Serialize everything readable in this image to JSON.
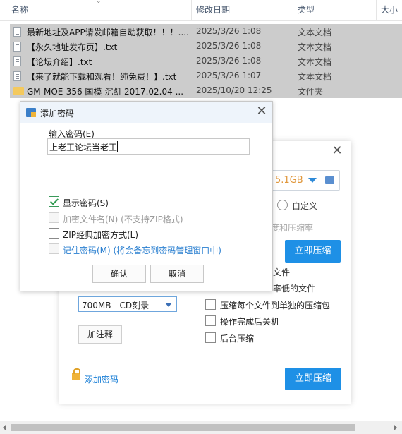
{
  "explorer": {
    "columns": {
      "name": "名称",
      "date": "修改日期",
      "type": "类型",
      "size": "大小"
    },
    "rows": [
      {
        "name": "最新地址及APP请发邮箱自动获取！！！....",
        "date": "2025/3/26 1:08",
        "type": "文本文档",
        "kind": "txt"
      },
      {
        "name": "【永久地址发布页】.txt",
        "date": "2025/3/26 1:08",
        "type": "文本文档",
        "kind": "txt"
      },
      {
        "name": "【论坛介绍】.txt",
        "date": "2025/3/26 1:08",
        "type": "文本文档",
        "kind": "txt"
      },
      {
        "name": "【来了就能下载和观看！纯免费！】.txt",
        "date": "2025/3/26 1:07",
        "type": "文本文档",
        "kind": "txt"
      },
      {
        "name": "GM-MOE-356 国模 沉凯 2017.02.04 ...",
        "date": "2025/10/20 12:25",
        "type": "文件夹",
        "kind": "folder"
      }
    ]
  },
  "zip_dialog": {
    "free_space": "5.1GB",
    "custom_radio": "自定义",
    "speed_partial": "度和压缩率",
    "compress_now": "立即压缩",
    "partial_file": "文件",
    "partial_lowrate": "率低的文件",
    "split_value": "700MB   - CD刻录",
    "add_comment": "加注释",
    "options": [
      "压缩每个文件到单独的压缩包",
      "操作完成后关机",
      "后台压缩"
    ],
    "add_password_link": "添加密码",
    "compress_now_bottom": "立即压缩"
  },
  "password_dialog": {
    "title": "添加密码",
    "input_label": "输入密码(E)",
    "password_value": "上老王论坛当老王",
    "show_password": "显示密码(S)",
    "encrypt_names": "加密文件名(N) (不支持ZIP格式)",
    "zip_classic": "ZIP经典加密方式(L)",
    "remember": "记住密码(M) (将会备忘到密码管理窗口中)",
    "ok": "确认",
    "cancel": "取消"
  },
  "colors": {
    "accent": "#1e90e6",
    "row_selected": "#cccccc",
    "link": "#1a7fd6"
  }
}
